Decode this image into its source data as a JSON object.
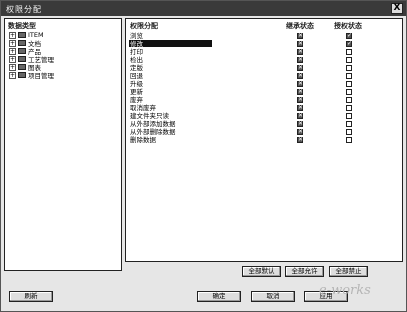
{
  "window": {
    "title": "权限分配",
    "close_label": "X"
  },
  "left_panel": {
    "header": "数据类型",
    "tree": [
      {
        "label": "ITEM"
      },
      {
        "label": "文档"
      },
      {
        "label": "产品"
      },
      {
        "label": "工艺管理"
      },
      {
        "label": "图表"
      },
      {
        "label": "项目管理"
      }
    ]
  },
  "right_panel": {
    "headers": {
      "name": "权限分配",
      "inherit": "继承状态",
      "grant": "授权状态"
    },
    "rows": [
      {
        "label": "浏览",
        "inherit": true,
        "grant": true
      },
      {
        "label": "修改",
        "inherit": true,
        "grant": true
      },
      {
        "label": "打印",
        "inherit": true,
        "grant": false
      },
      {
        "label": "检出",
        "inherit": true,
        "grant": false
      },
      {
        "label": "定版",
        "inherit": true,
        "grant": false
      },
      {
        "label": "回退",
        "inherit": true,
        "grant": false
      },
      {
        "label": "升级",
        "inherit": true,
        "grant": false
      },
      {
        "label": "更新",
        "inherit": true,
        "grant": false
      },
      {
        "label": "废弃",
        "inherit": true,
        "grant": false
      },
      {
        "label": "取消废弃",
        "inherit": true,
        "grant": false
      },
      {
        "label": "建文件夹只读",
        "inherit": true,
        "grant": false
      },
      {
        "label": "从外部添加数据",
        "inherit": true,
        "grant": false
      },
      {
        "label": "从外部删除数据",
        "inherit": true,
        "grant": false
      },
      {
        "label": "删除数据",
        "inherit": true,
        "grant": false
      }
    ],
    "selected_index": 1
  },
  "buttons": {
    "all_default": "全部默认",
    "all_allow": "全部允许",
    "all_deny": "全部禁止",
    "refresh": "刷新",
    "ok": "确定",
    "cancel": "取消",
    "apply": "应用"
  },
  "watermark": "e-works"
}
